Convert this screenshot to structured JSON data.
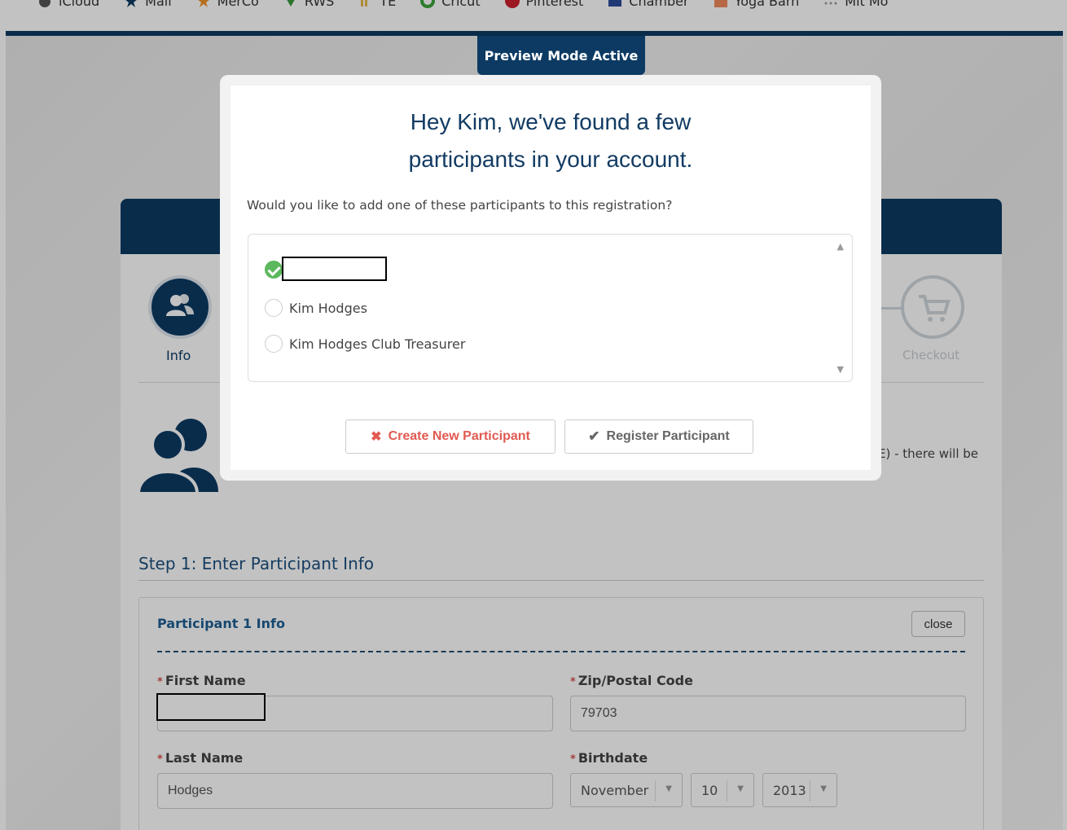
{
  "bookmarks": [
    {
      "label": "iCloud",
      "icon": "apple-icon"
    },
    {
      "label": "Mail",
      "icon": "star-icon"
    },
    {
      "label": "MerCo",
      "icon": "star-orange-icon"
    },
    {
      "label": "RWS",
      "icon": "arrow-down-icon"
    },
    {
      "label": "TE",
      "icon": "bars-icon"
    },
    {
      "label": "Cricut",
      "icon": "cricut-icon"
    },
    {
      "label": "Pinterest",
      "icon": "pinterest-icon"
    },
    {
      "label": "Chamber",
      "icon": "chamber-icon"
    },
    {
      "label": "Yoga Barn",
      "icon": "yoga-icon"
    },
    {
      "label": "Mit Mo",
      "icon": "dots-icon"
    }
  ],
  "preview": {
    "label": "Preview Mode Active"
  },
  "modal": {
    "title_line1": "Hey Kim, we've found a few",
    "title_line2": "participants in your account.",
    "question": "Would you like to add one of these participants to this registration?",
    "participants": [
      {
        "name": "",
        "selected": true
      },
      {
        "name": "Kim Hodges",
        "selected": false
      },
      {
        "name": "Kim Hodges Club Treasurer",
        "selected": false
      }
    ],
    "create_button": "Create New Participant",
    "register_button": "Register Participant"
  },
  "steps": {
    "info_label": "Info",
    "checkout_label": "Checkout"
  },
  "description_tail": "E) - there will be",
  "step1": {
    "title": "Step 1: Enter Participant Info"
  },
  "participant_box": {
    "title": "Participant 1 Info",
    "close_label": "close",
    "fields": {
      "first_name_label": "First Name",
      "first_name_value": "",
      "zip_label": "Zip/Postal Code",
      "zip_value": "79703",
      "last_name_label": "Last Name",
      "last_name_value": "Hodges",
      "birthdate_label": "Birthdate",
      "birth_month": "November",
      "birth_day": "10",
      "birth_year": "2013"
    }
  },
  "colors": {
    "navy": "#0c3a63",
    "title_blue": "#123b63",
    "danger": "#e05a52",
    "success": "#5cb85c"
  }
}
